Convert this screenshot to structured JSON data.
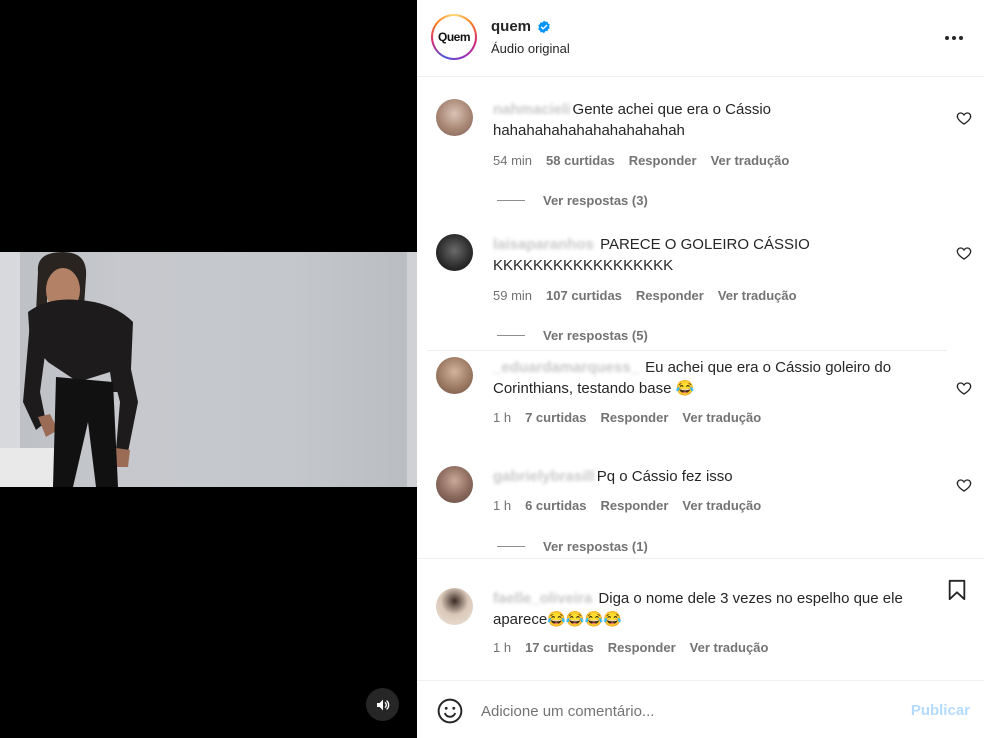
{
  "post": {
    "author": "quem",
    "avatar_text": "Quem",
    "audio": "Áudio original",
    "brand_ring_colors": [
      "#feda75",
      "#fa7e1e",
      "#d62976",
      "#962fbf",
      "#4f5bd5"
    ],
    "verified_color": "#0095f6"
  },
  "comments": [
    {
      "user": "nahmacieli",
      "text_prefix": "G",
      "text": "ente achei que era o Cássio hahahahahahahahahahahah",
      "time": "54 min",
      "likes": "58 curtidas",
      "reply": "Responder",
      "translate": "Ver tradução",
      "replies": "Ver respostas (3)"
    },
    {
      "user": "laisaparanhos",
      "text": "PARECE O GOLEIRO CÁSSIO KKKKKKKKKKKKKKKKKK",
      "time": "59 min",
      "likes": "107 curtidas",
      "reply": "Responder",
      "translate": "Ver tradução",
      "replies": "Ver respostas (5)"
    },
    {
      "user": "_eduardamarquess_",
      "text": "Eu achei que era o Cássio goleiro do Corinthians, testando base 😂",
      "time": "1 h",
      "likes": "7 curtidas",
      "reply": "Responder",
      "translate": "Ver tradução"
    },
    {
      "user": "gabrielybrasill",
      "text_prefix": "P",
      "text": "q o Cássio fez isso",
      "time": "1 h",
      "likes": "6 curtidas",
      "reply": "Responder",
      "translate": "Ver tradução",
      "replies": "Ver respostas (1)"
    },
    {
      "user": "faelle_oliveira",
      "text": "Diga o nome dele 3 vezes no espelho que ele aparece😂😂😂😂",
      "time": "1 h",
      "likes": "17 curtidas",
      "reply": "Responder",
      "translate": "Ver tradução"
    }
  ],
  "composer": {
    "placeholder": "Adicione um comentário...",
    "publish": "Publicar",
    "publish_color": "#b3dbff"
  },
  "icons": [
    "speaker-icon",
    "verified-icon",
    "more-icon",
    "heart-icon",
    "bookmark-icon",
    "emoji-icon"
  ]
}
